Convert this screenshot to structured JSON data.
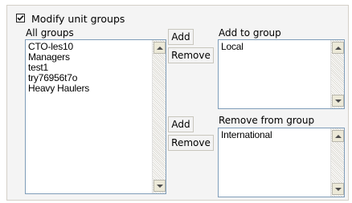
{
  "modify_checkbox": {
    "label": "Modify unit groups",
    "checked": true
  },
  "all_groups": {
    "label": "All groups",
    "items": [
      "CTO-les10",
      "Managers",
      "test1",
      "try76956t7o",
      "Heavy Haulers"
    ]
  },
  "add_to_group": {
    "label": "Add to group",
    "items": [
      "Local"
    ],
    "add_label": "Add",
    "remove_label": "Remove"
  },
  "remove_from_group": {
    "label": "Remove from group",
    "items": [
      "International"
    ],
    "add_label": "Add",
    "remove_label": "Remove"
  },
  "colors": {
    "listbox_border": "#7f9db9",
    "panel_bg": "#f4f4f4",
    "button_bg": "#f3f3f3"
  },
  "icons": [
    "checkmark-icon",
    "scroll-up-arrow-icon",
    "scroll-down-arrow-icon"
  ]
}
